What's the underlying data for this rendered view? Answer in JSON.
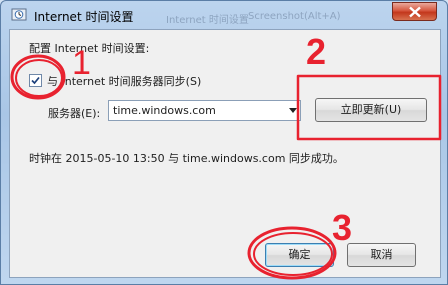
{
  "window": {
    "title": "Internet 时间设置",
    "ghost_title": "Internet 时间设置",
    "ghost_hint": "Screenshot(Alt+A)"
  },
  "form": {
    "heading": "配置 Internet 时间设置:",
    "sync_label": "与 Internet 时间服务器同步(S)",
    "sync_checked": true,
    "server_label": "服务器(E):",
    "server_value": "time.windows.com",
    "update_button": "立即更新(U)",
    "status": "时钟在 2015-05-10 13:50 与 time.windows.com 同步成功。"
  },
  "buttons": {
    "ok": "确定",
    "cancel": "取消"
  },
  "annotations": {
    "color": "#e8222f",
    "steps": [
      "1",
      "2",
      "3"
    ]
  }
}
